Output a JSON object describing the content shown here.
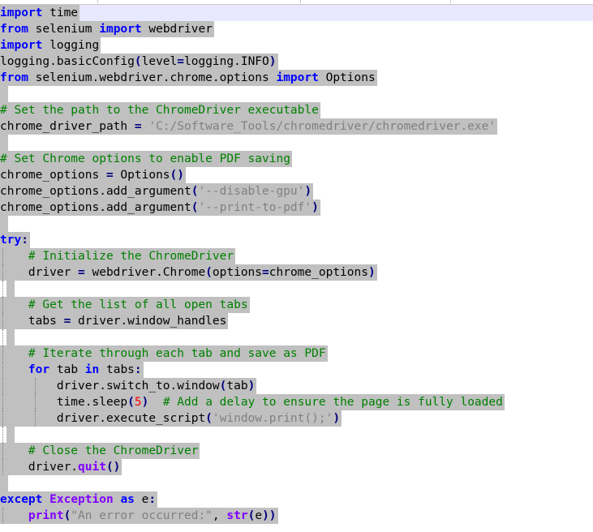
{
  "editor": {
    "lines": [
      [
        "import",
        " time"
      ],
      [
        "from",
        " selenium ",
        "import",
        " webdriver"
      ],
      [
        "import",
        " logging"
      ],
      [
        "logging.basicConfig",
        "(",
        "level",
        "=",
        "logging.INFO",
        ")"
      ],
      [
        "from",
        " selenium.webdriver.chrome.options ",
        "import",
        " Options"
      ],
      [],
      [
        "# Set the path to the ChromeDriver executable"
      ],
      [
        "chrome_driver_path ",
        "=",
        " ",
        "'C:/Software_Tools/chromedriver/chromedriver.exe'"
      ],
      [],
      [
        "# Set Chrome options to enable PDF saving"
      ],
      [
        "chrome_options ",
        "=",
        " Options",
        "()"
      ],
      [
        "chrome_options.add_argument",
        "(",
        "'--disable-gpu'",
        ")"
      ],
      [
        "chrome_options.add_argument",
        "(",
        "'--print-to-pdf'",
        ")"
      ],
      [],
      [
        "try",
        ":"
      ],
      [
        "    ",
        "# Initialize the ChromeDriver"
      ],
      [
        "    ",
        "driver ",
        "=",
        " webdriver.Chrome",
        "(",
        "options",
        "=",
        "chrome_options",
        ")"
      ],
      [],
      [
        "    ",
        "# Get the list of all open tabs"
      ],
      [
        "    ",
        "tabs ",
        "=",
        " driver.window_handles"
      ],
      [],
      [
        "    ",
        "# Iterate through each tab and save as PDF"
      ],
      [
        "    ",
        "for",
        " tab ",
        "in",
        " tabs",
        ":"
      ],
      [
        "        ",
        "driver.switch_to.window",
        "(",
        "tab",
        ")"
      ],
      [
        "        ",
        "time.sleep",
        "(",
        "5",
        ")",
        "  ",
        "# Add a delay to ensure the page is fully loaded"
      ],
      [
        "        ",
        "driver.execute_script",
        "(",
        "'window.print();'",
        ")"
      ],
      [],
      [
        "    ",
        "# Close the ChromeDriver"
      ],
      [
        "    ",
        "driver.",
        "quit",
        "()"
      ],
      [],
      [
        "except",
        " ",
        "Exception",
        " ",
        "as",
        " e",
        ":"
      ],
      [
        "    ",
        "print",
        "(",
        "\"An error occurred:\"",
        ", ",
        "str",
        "(",
        "e",
        "))"
      ]
    ]
  },
  "colors": {
    "keyword": "#0000ff",
    "builtin": "#8000ff",
    "operator": "#000080",
    "string": "#808080",
    "number": "#ff0000",
    "comment": "#008000",
    "selection": "#c0c0c0",
    "current_line": "#e8e8ff"
  }
}
